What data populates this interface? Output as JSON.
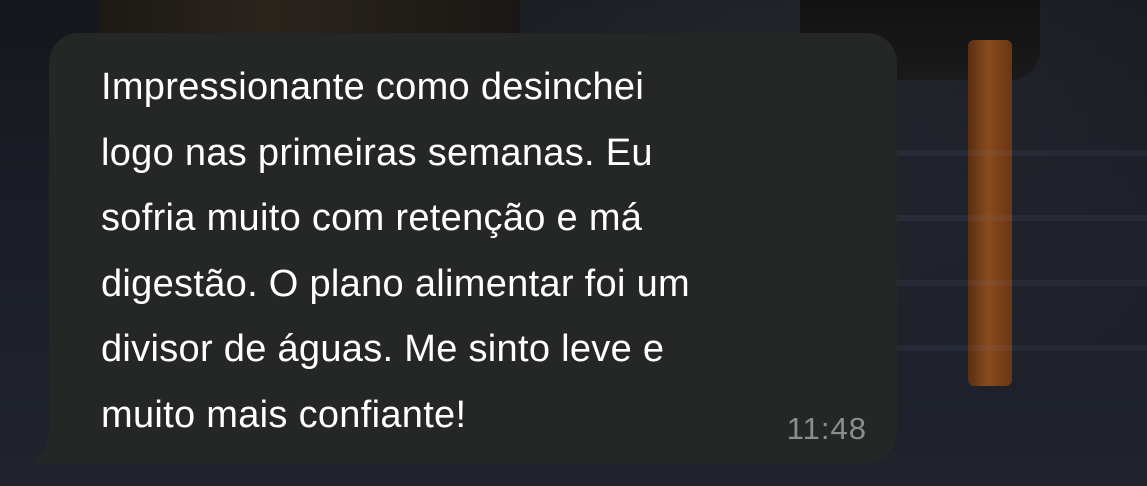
{
  "message": {
    "lines": [
      "Impressionante como desinchei",
      "logo nas primeiras semanas. Eu",
      "sofria muito com retenção e má",
      "digestão. O plano alimentar foi um",
      "divisor de águas. Me sinto leve e",
      "muito mais confiante!"
    ],
    "time": "11:48"
  },
  "colors": {
    "bubble": "#252626",
    "text": "#ffffff",
    "time": "#8b8d8f"
  }
}
